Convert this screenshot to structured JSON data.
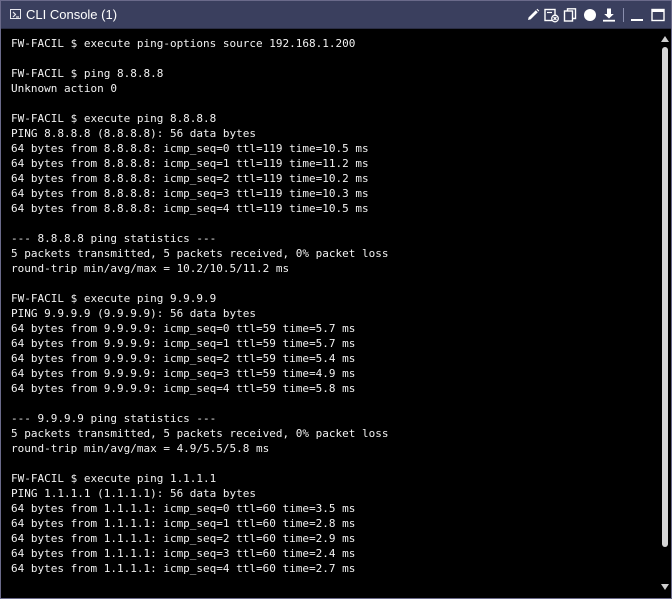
{
  "window": {
    "title": "CLI Console (1)",
    "icons": [
      "terminal-icon",
      "edit-icon",
      "clear-icon",
      "copy-icon",
      "record-icon",
      "download-icon",
      "minimize-icon",
      "maximize-icon"
    ]
  },
  "console": {
    "lines": [
      "FW-FACIL $ execute ping-options source 192.168.1.200",
      "",
      "FW-FACIL $ ping 8.8.8.8",
      "Unknown action 0",
      "",
      "FW-FACIL $ execute ping 8.8.8.8",
      "PING 8.8.8.8 (8.8.8.8): 56 data bytes",
      "64 bytes from 8.8.8.8: icmp_seq=0 ttl=119 time=10.5 ms",
      "64 bytes from 8.8.8.8: icmp_seq=1 ttl=119 time=11.2 ms",
      "64 bytes from 8.8.8.8: icmp_seq=2 ttl=119 time=10.2 ms",
      "64 bytes from 8.8.8.8: icmp_seq=3 ttl=119 time=10.3 ms",
      "64 bytes from 8.8.8.8: icmp_seq=4 ttl=119 time=10.5 ms",
      "",
      "--- 8.8.8.8 ping statistics ---",
      "5 packets transmitted, 5 packets received, 0% packet loss",
      "round-trip min/avg/max = 10.2/10.5/11.2 ms",
      "",
      "FW-FACIL $ execute ping 9.9.9.9",
      "PING 9.9.9.9 (9.9.9.9): 56 data bytes",
      "64 bytes from 9.9.9.9: icmp_seq=0 ttl=59 time=5.7 ms",
      "64 bytes from 9.9.9.9: icmp_seq=1 ttl=59 time=5.7 ms",
      "64 bytes from 9.9.9.9: icmp_seq=2 ttl=59 time=5.4 ms",
      "64 bytes from 9.9.9.9: icmp_seq=3 ttl=59 time=4.9 ms",
      "64 bytes from 9.9.9.9: icmp_seq=4 ttl=59 time=5.8 ms",
      "",
      "--- 9.9.9.9 ping statistics ---",
      "5 packets transmitted, 5 packets received, 0% packet loss",
      "round-trip min/avg/max = 4.9/5.5/5.8 ms",
      "",
      "FW-FACIL $ execute ping 1.1.1.1",
      "PING 1.1.1.1 (1.1.1.1): 56 data bytes",
      "64 bytes from 1.1.1.1: icmp_seq=0 ttl=60 time=3.5 ms",
      "64 bytes from 1.1.1.1: icmp_seq=1 ttl=60 time=2.8 ms",
      "64 bytes from 1.1.1.1: icmp_seq=2 ttl=60 time=2.9 ms",
      "64 bytes from 1.1.1.1: icmp_seq=3 ttl=60 time=2.4 ms",
      "64 bytes from 1.1.1.1: icmp_seq=4 ttl=60 time=2.7 ms"
    ]
  },
  "colors": {
    "titlebar": "#3a3f5e",
    "console_bg": "#000000",
    "console_text": "#f2f2f2"
  }
}
